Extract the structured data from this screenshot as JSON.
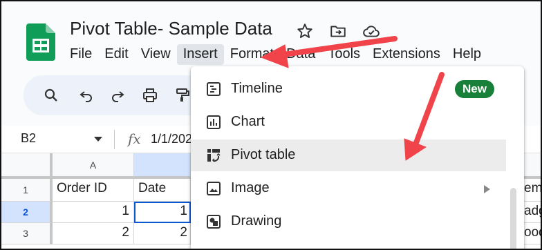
{
  "app": {
    "doc_title": "Pivot Table- Sample Data",
    "brand_color": "#0f9d58",
    "icons": [
      "star-icon",
      "move-to-folder-icon",
      "cloud-saved-icon"
    ]
  },
  "menubar": {
    "items": [
      {
        "label": "File"
      },
      {
        "label": "Edit"
      },
      {
        "label": "View"
      },
      {
        "label": "Insert",
        "active": true
      },
      {
        "label": "Format"
      },
      {
        "label": "Data"
      },
      {
        "label": "Tools"
      },
      {
        "label": "Extensions"
      },
      {
        "label": "Help"
      }
    ]
  },
  "toolbar": {
    "icons": [
      "search-icon",
      "undo-icon",
      "redo-icon",
      "print-icon",
      "paint-format-icon"
    ]
  },
  "formula_bar": {
    "cell_ref": "B2",
    "fx": "fx",
    "value": "1/1/202"
  },
  "grid": {
    "column_headers": [
      "A"
    ],
    "row_numbers": [
      "1",
      "2",
      "3"
    ],
    "selected_row": "2",
    "cells": {
      "a1": "Order ID",
      "b1": "Date",
      "a2": "1",
      "a3": "2",
      "b2": "1",
      "b3": "2",
      "partial_right_1": "em",
      "partial_right_2": "adg",
      "partial_right_3": "ood"
    }
  },
  "insert_menu": {
    "items": [
      {
        "label": "Timeline",
        "icon": "timeline-icon",
        "badge": "New"
      },
      {
        "label": "Chart",
        "icon": "chart-icon"
      },
      {
        "label": "Pivot table",
        "icon": "pivot-table-icon",
        "highlighted": true
      },
      {
        "label": "Image",
        "icon": "image-icon",
        "submenu": true
      },
      {
        "label": "Drawing",
        "icon": "drawing-icon"
      }
    ],
    "badge_color": "#188038"
  },
  "annotations": {
    "arrow_color": "#f0444a",
    "arrows": [
      "arrow-to-insert-menu",
      "arrow-to-pivot-table"
    ]
  }
}
